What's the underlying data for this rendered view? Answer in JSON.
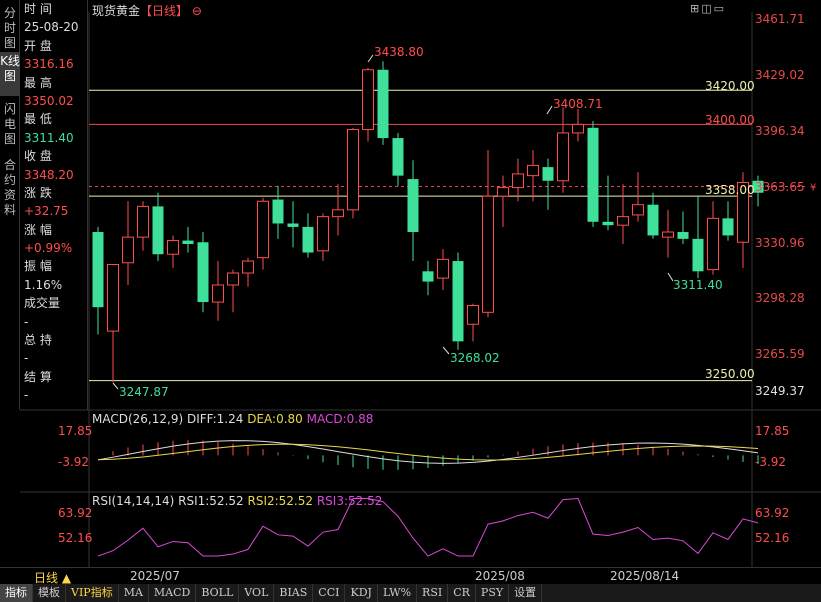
{
  "vtabs": [
    "分时图",
    "K线图",
    "闪电图",
    "合约资料"
  ],
  "info": {
    "time_label": "时 间",
    "time_value": "25-08-20",
    "open_label": "开 盘",
    "open_value": "3316.16",
    "high_label": "最 高",
    "high_value": "3350.02",
    "low_label": "最 低",
    "low_value": "3311.40",
    "close_label": "收 盘",
    "close_value": "3348.20",
    "change_label": "涨 跌",
    "change_value": "+32.75",
    "pct_label": "涨 幅",
    "pct_value": "+0.99%",
    "amp_label": "振 幅",
    "amp_value": "1.16%",
    "vol_label": "成交量",
    "vol_value": "-",
    "oi_label": "总 持",
    "oi_value": "-",
    "settle_label": "结 算",
    "settle_value": "-"
  },
  "main": {
    "name": "现货黄金",
    "period": "【日线】",
    "settings_icon": "⊖",
    "toolbar": "⊞◫▭"
  },
  "price_axis": [
    "3461.71",
    "3429.02",
    "3396.34",
    "3363.65",
    "3330.96",
    "3298.28",
    "3265.59",
    "3249.37"
  ],
  "hlines": [
    "3420.00",
    "3400.00",
    "3358.00",
    "3250.00"
  ],
  "annotations": {
    "high1": "3438.80",
    "high2": "3408.71",
    "low1": "3247.87",
    "low2": "3268.02",
    "low3": "3311.40"
  },
  "chart_data": {
    "type": "candlestick",
    "ohlc": [
      [
        3337,
        3340,
        3277,
        3293
      ],
      [
        3279,
        3305,
        3249,
        3318
      ],
      [
        3319,
        3355,
        3306,
        3334
      ],
      [
        3334,
        3355,
        3326,
        3352
      ],
      [
        3352,
        3360,
        3320,
        3324
      ],
      [
        3324,
        3335,
        3316,
        3332
      ],
      [
        3332,
        3340,
        3325,
        3330
      ],
      [
        3331,
        3337,
        3290,
        3296
      ],
      [
        3296,
        3320,
        3285,
        3306
      ],
      [
        3306,
        3315,
        3290,
        3313
      ],
      [
        3313,
        3322,
        3305,
        3320
      ],
      [
        3322,
        3357,
        3315,
        3355
      ],
      [
        3356,
        3364,
        3333,
        3342
      ],
      [
        3342,
        3355,
        3328,
        3340
      ],
      [
        3340,
        3348,
        3322,
        3325
      ],
      [
        3326,
        3348,
        3320,
        3346
      ],
      [
        3346,
        3365,
        3335,
        3350
      ],
      [
        3350,
        3398,
        3345,
        3397
      ],
      [
        3397,
        3433,
        3390,
        3432
      ],
      [
        3432,
        3437,
        3388,
        3392
      ],
      [
        3392,
        3395,
        3364,
        3370
      ],
      [
        3368,
        3379,
        3320,
        3337
      ],
      [
        3314,
        3320,
        3300,
        3308
      ],
      [
        3310,
        3327,
        3303,
        3321
      ],
      [
        3320,
        3325,
        3268,
        3273
      ],
      [
        3283,
        3295,
        3273,
        3294
      ],
      [
        3290,
        3385,
        3287,
        3358
      ],
      [
        3358,
        3370,
        3340,
        3363
      ],
      [
        3363,
        3380,
        3355,
        3371
      ],
      [
        3370,
        3385,
        3355,
        3376
      ],
      [
        3375,
        3380,
        3350,
        3367
      ],
      [
        3367,
        3410,
        3360,
        3395
      ],
      [
        3395,
        3409,
        3390,
        3400
      ],
      [
        3398,
        3402,
        3340,
        3343
      ],
      [
        3343,
        3370,
        3338,
        3341
      ],
      [
        3341,
        3365,
        3330,
        3346
      ],
      [
        3347,
        3372,
        3343,
        3353
      ],
      [
        3353,
        3360,
        3333,
        3335
      ],
      [
        3334,
        3350,
        3322,
        3337
      ],
      [
        3337,
        3349,
        3330,
        3333
      ],
      [
        3333,
        3358,
        3310,
        3314
      ],
      [
        3315,
        3355,
        3312,
        3345
      ],
      [
        3345,
        3355,
        3332,
        3335
      ],
      [
        3331,
        3372,
        3316,
        3366
      ],
      [
        3367,
        3370,
        3352,
        3360
      ]
    ]
  },
  "macd": {
    "title": "MACD(26,12,9)",
    "diff": "DIFF:1.24",
    "dea": "DEA:0.80",
    "macd": "MACD:0.88",
    "top": "17.85",
    "bottom": "-3.92"
  },
  "rsi": {
    "title": "RSI(14,14,14)",
    "rsi1": "RSI1:52.52",
    "rsi2": "RSI2:52.52",
    "rsi3": "RSI3:52.52",
    "top": "63.92",
    "bottom": "52.16"
  },
  "time_axis": {
    "period": "日线 ▲",
    "dates": [
      "2025/07",
      "2025/08",
      "2025/08/14"
    ]
  },
  "bottom_tabs": [
    "指标",
    "模板",
    "VIP指标",
    "MA",
    "MACD",
    "BOLL",
    "VOL",
    "BIAS",
    "CCI",
    "KDJ",
    "LW%",
    "RSI",
    "CR",
    "PSY",
    "设置"
  ],
  "colors": {
    "up": "#ff4d4d",
    "down": "#3ee09a",
    "hline": "#f3f0b0",
    "hline_red": "#e84a4a"
  }
}
